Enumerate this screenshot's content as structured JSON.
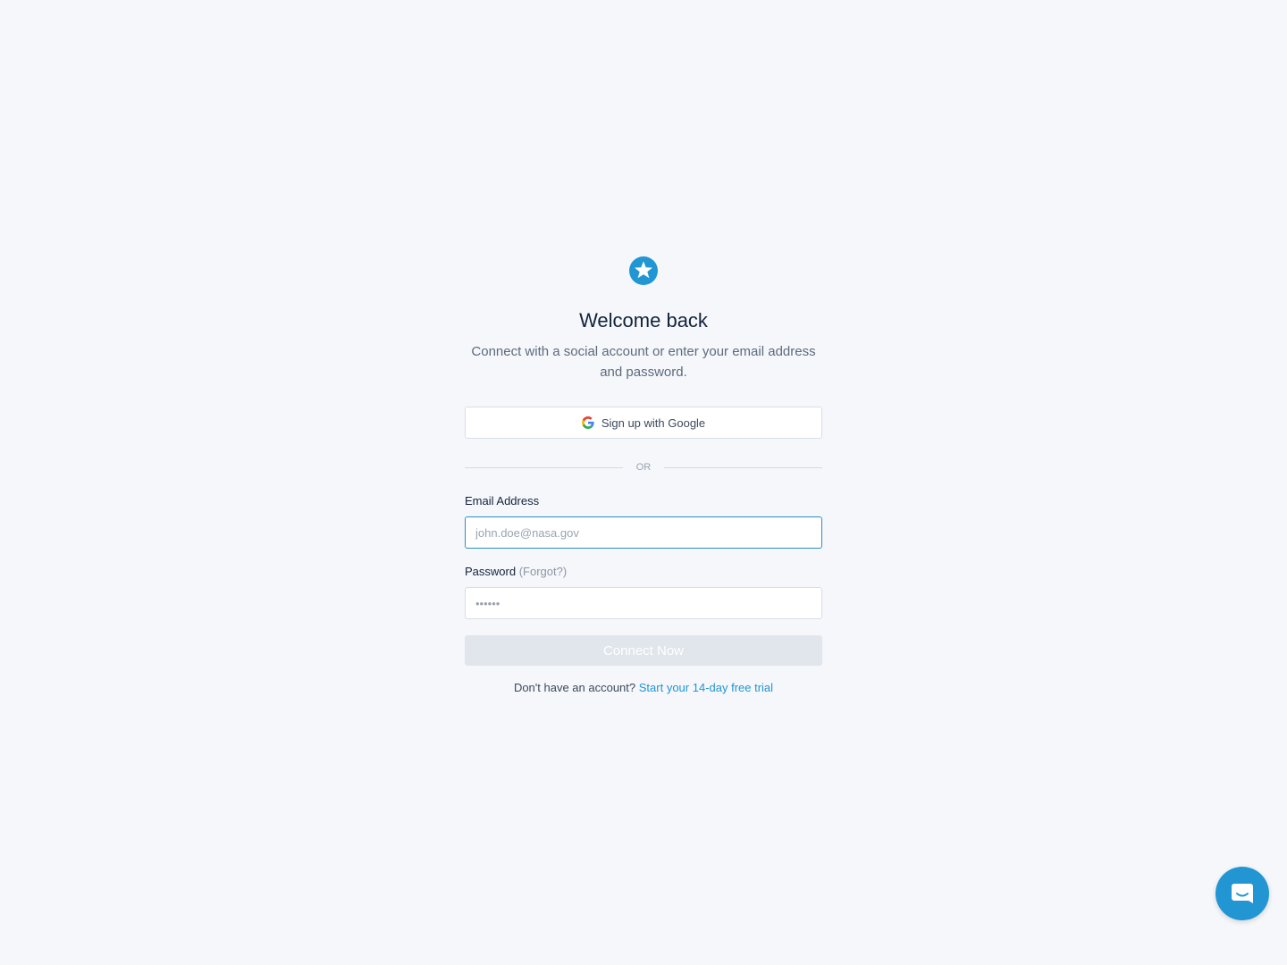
{
  "brand": {
    "logo_icon": "star-badge-icon",
    "accent_color": "#2196d3"
  },
  "header": {
    "title": "Welcome back",
    "subtitle": "Connect with a social account or enter your email address and password."
  },
  "social": {
    "google_label": "Sign up with Google",
    "google_icon": "google-g-icon"
  },
  "divider": {
    "text": "OR"
  },
  "form": {
    "email_label": "Email Address",
    "email_placeholder": "john.doe@nasa.gov",
    "email_value": "",
    "password_label": "Password",
    "forgot_label": "(Forgot?)",
    "password_placeholder": "••••••",
    "password_value": "",
    "submit_label": "Connect Now"
  },
  "footer": {
    "prompt": "Don't have an account?",
    "trial_link": "Start your 14-day free trial"
  },
  "chat": {
    "icon": "chat-bubble-icon"
  }
}
